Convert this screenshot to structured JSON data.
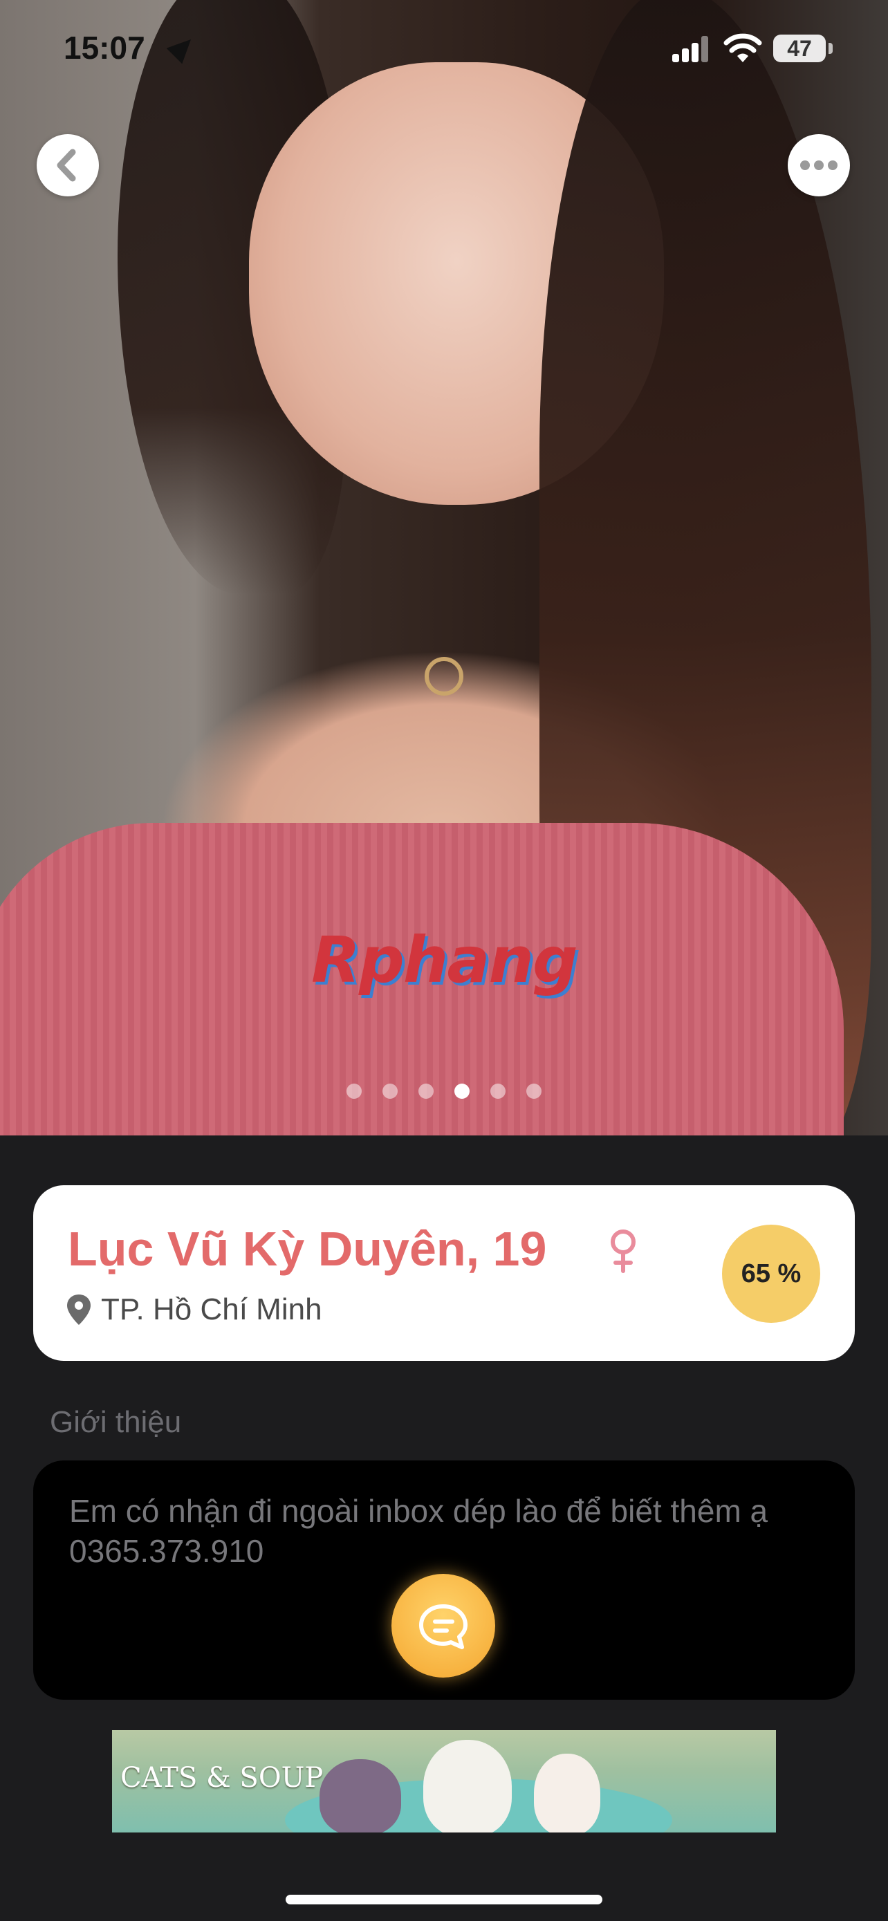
{
  "status_bar": {
    "time": "15:07",
    "battery": "47"
  },
  "hero": {
    "watermark": "Rphang",
    "photo_count": 6,
    "active_photo_index": 4
  },
  "profile": {
    "name_age": "Lục Vũ Kỳ Duyên, 19",
    "location": "TP. Hồ Chí Minh",
    "match": "65 %",
    "gender_icon": "female-icon"
  },
  "intro": {
    "title": "Giới thiệu",
    "text": "Em có nhận đi ngoài inbox dép lào để biết thêm ạ 0365.373.910"
  },
  "ad": {
    "title": "CATS & SOUP"
  },
  "colors": {
    "name": "#e36a6a",
    "match_badge": "#f5cd68",
    "background": "#1c1c1e"
  }
}
